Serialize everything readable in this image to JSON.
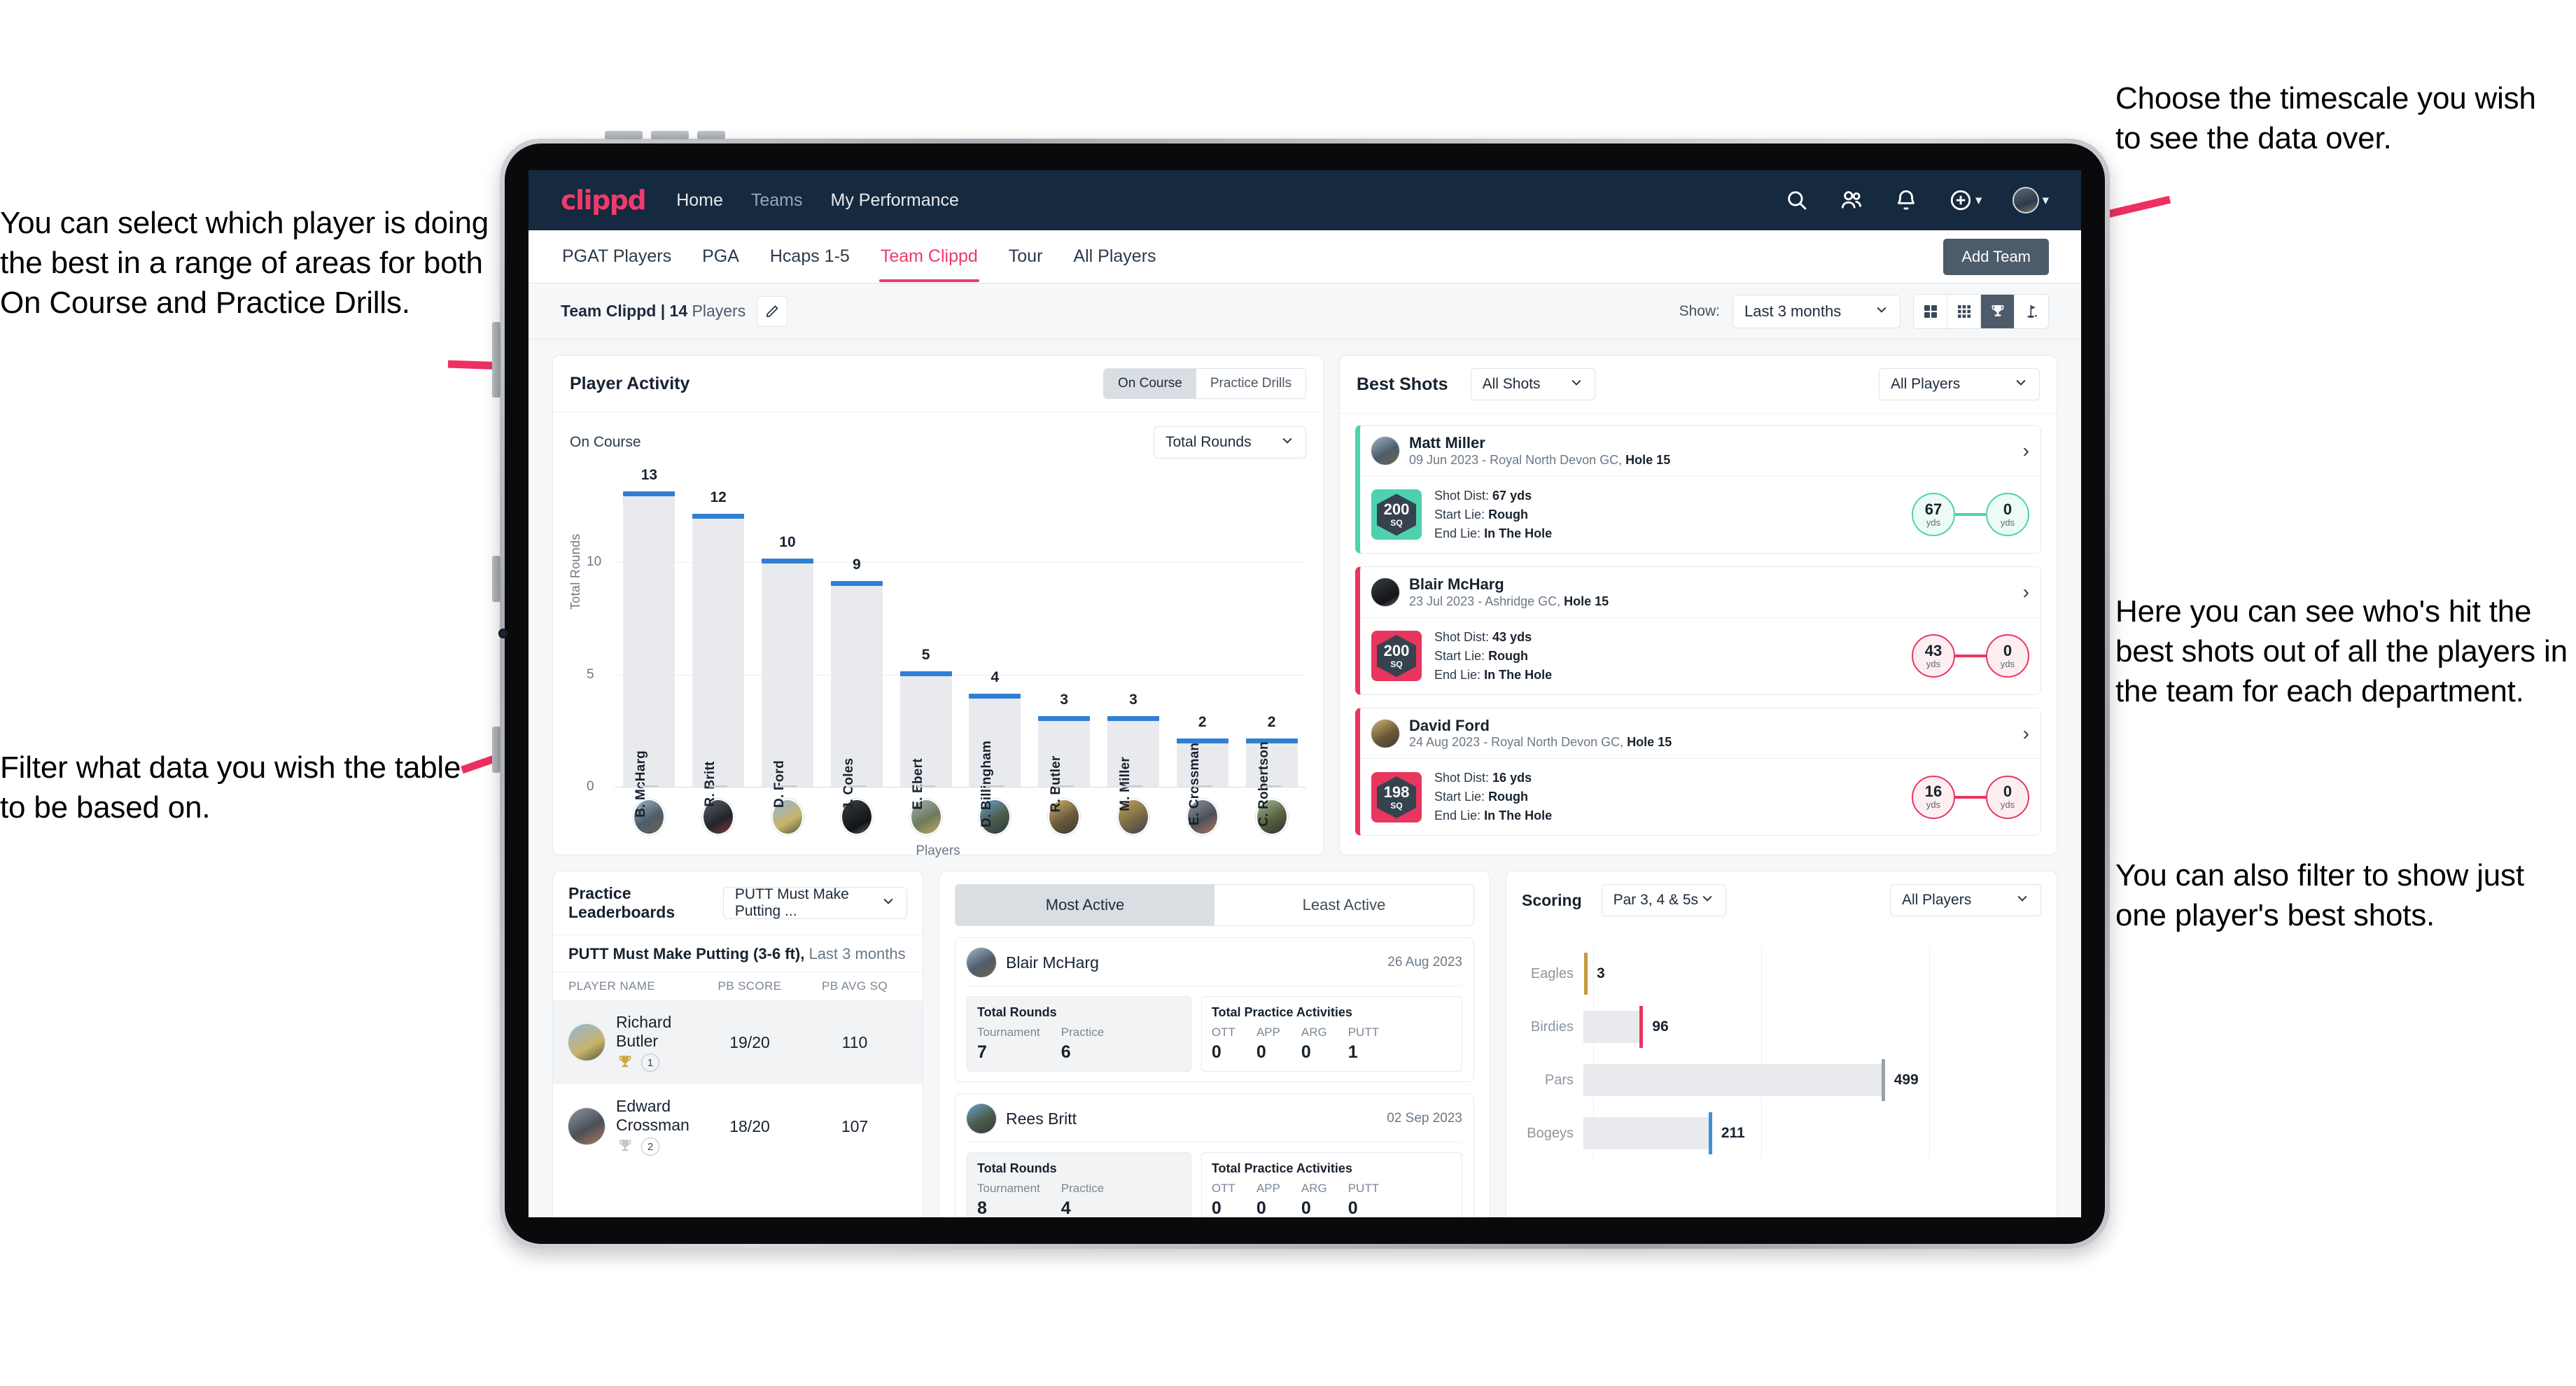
{
  "annotations": {
    "left_top": "You can select which player is doing the best in a range of areas for both On Course and Practice Drills.",
    "left_bottom": "Filter what data you wish the table to be based on.",
    "right_top": "Choose the timescale you wish to see the data over.",
    "right_middle": "Here you can see who's hit the best shots out of all the players in the team for each department.",
    "right_bottom": "You can also filter to show just one player's best shots."
  },
  "app": {
    "logo": "clippd",
    "nav": [
      {
        "label": "Home",
        "active": true
      },
      {
        "label": "Teams",
        "active": false
      },
      {
        "label": "My Performance",
        "active": false
      }
    ],
    "header_icons": [
      "search-icon",
      "people-icon",
      "bell-icon",
      "plus-circle-icon",
      "avatar"
    ],
    "tabs": [
      {
        "label": "PGAT Players",
        "active": false
      },
      {
        "label": "PGA",
        "active": false
      },
      {
        "label": "Hcaps 1-5",
        "active": false
      },
      {
        "label": "Team Clippd",
        "active": true
      },
      {
        "label": "Tour",
        "active": false
      },
      {
        "label": "All Players",
        "active": false
      }
    ],
    "add_team_label": "Add Team",
    "subbar": {
      "team_label": "Team Clippd",
      "separator": "|",
      "player_count": "14",
      "players_word": "Players",
      "show_label": "Show:",
      "timescale_value": "Last 3 months",
      "view_modes": [
        "grid-2x2-icon",
        "grid-3x3-icon",
        "trophy-icon",
        "golf-flag-icon"
      ],
      "active_view_index": 2
    }
  },
  "player_activity": {
    "title": "Player Activity",
    "segments": [
      {
        "label": "On Course",
        "active": true
      },
      {
        "label": "Practice Drills",
        "active": false
      }
    ],
    "sub_label": "On Course",
    "metric_select": "Total Rounds"
  },
  "chart_data": {
    "type": "bar",
    "title": "Player Activity",
    "xlabel": "Players",
    "ylabel": "Total Rounds",
    "categories": [
      "B. McHarg",
      "R. Britt",
      "D. Ford",
      "J. Coles",
      "E. Ebert",
      "D. Billingham",
      "R. Butler",
      "M. Miller",
      "E. Crossman",
      "C. Robertson"
    ],
    "values": [
      13,
      12,
      10,
      9,
      5,
      4,
      3,
      3,
      2,
      2
    ],
    "ylim": [
      0,
      14
    ],
    "yticks": [
      0,
      5,
      10
    ],
    "grid": true,
    "bar_cap_color": "#2f7fd4",
    "bar_color": "#e8eaee"
  },
  "best_shots": {
    "title": "Best Shots",
    "filter_shots": "All Shots",
    "filter_players": "All Players",
    "items": [
      {
        "name": "Matt Miller",
        "meta_date": "09 Jun 2023 - Royal North Devon GC,",
        "meta_hole": "Hole 15",
        "sq": "200",
        "sq_unit": "SQ",
        "accent": "#4ed2ae",
        "shot_dist_label": "Shot Dist:",
        "shot_dist": "67 yds",
        "start_lie_label": "Start Lie:",
        "start_lie": "Rough",
        "end_lie_label": "End Lie:",
        "end_lie": "In The Hole",
        "from_val": "67",
        "from_unit": "yds",
        "to_val": "0",
        "to_unit": "yds"
      },
      {
        "name": "Blair McHarg",
        "meta_date": "23 Jul 2023 - Ashridge GC,",
        "meta_hole": "Hole 15",
        "sq": "200",
        "sq_unit": "SQ",
        "accent": "#e8365f",
        "shot_dist_label": "Shot Dist:",
        "shot_dist": "43 yds",
        "start_lie_label": "Start Lie:",
        "start_lie": "Rough",
        "end_lie_label": "End Lie:",
        "end_lie": "In The Hole",
        "from_val": "43",
        "from_unit": "yds",
        "to_val": "0",
        "to_unit": "yds"
      },
      {
        "name": "David Ford",
        "meta_date": "24 Aug 2023 - Royal North Devon GC,",
        "meta_hole": "Hole 15",
        "sq": "198",
        "sq_unit": "SQ",
        "accent": "#e8365f",
        "shot_dist_label": "Shot Dist:",
        "shot_dist": "16 yds",
        "start_lie_label": "Start Lie:",
        "start_lie": "Rough",
        "end_lie_label": "End Lie:",
        "end_lie": "In The Hole",
        "from_val": "16",
        "from_unit": "yds",
        "to_val": "0",
        "to_unit": "yds"
      }
    ]
  },
  "practice_leaderboards": {
    "title": "Practice Leaderboards",
    "drill_select": "PUTT Must Make Putting ...",
    "subtitle_bold": "PUTT Must Make Putting (3-6 ft),",
    "subtitle_light": "Last 3 months",
    "columns": [
      "PLAYER NAME",
      "PB SCORE",
      "PB AVG SQ"
    ],
    "rows": [
      {
        "name": "Richard Butler",
        "rank": "1",
        "trophy": "gold",
        "pb_score": "19/20",
        "pb_avg_sq": "110"
      },
      {
        "name": "Edward Crossman",
        "rank": "2",
        "trophy": "silver",
        "pb_score": "18/20",
        "pb_avg_sq": "107"
      }
    ]
  },
  "activity": {
    "tabs": [
      {
        "label": "Most Active",
        "active": true
      },
      {
        "label": "Least Active",
        "active": false
      }
    ],
    "cards": [
      {
        "name": "Blair McHarg",
        "date": "26 Aug 2023",
        "rounds_title": "Total Rounds",
        "rounds_keys": [
          "Tournament",
          "Practice"
        ],
        "rounds_vals": [
          "7",
          "6"
        ],
        "practice_title": "Total Practice Activities",
        "practice_keys": [
          "OTT",
          "APP",
          "ARG",
          "PUTT"
        ],
        "practice_vals": [
          "0",
          "0",
          "0",
          "1"
        ]
      },
      {
        "name": "Rees Britt",
        "date": "02 Sep 2023",
        "rounds_title": "Total Rounds",
        "rounds_keys": [
          "Tournament",
          "Practice"
        ],
        "rounds_vals": [
          "8",
          "4"
        ],
        "practice_title": "Total Practice Activities",
        "practice_keys": [
          "OTT",
          "APP",
          "ARG",
          "PUTT"
        ],
        "practice_vals": [
          "0",
          "0",
          "0",
          "0"
        ]
      }
    ]
  },
  "scoring": {
    "title": "Scoring",
    "filter_par": "Par 3, 4 & 5s",
    "filter_players": "All Players",
    "chart": {
      "type": "bar",
      "orientation": "horizontal",
      "categories": [
        "Eagles",
        "Birdies",
        "Pars",
        "Bogeys"
      ],
      "values": [
        3,
        96,
        499,
        211
      ],
      "colors": [
        "#c49a3c",
        "#e8365f",
        "#9aa3ab",
        "#3d8fd6"
      ],
      "xmax": 560,
      "grid": true
    }
  }
}
